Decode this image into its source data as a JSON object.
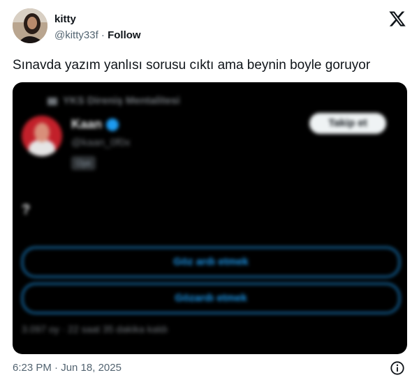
{
  "author": {
    "name": "kitty",
    "handle": "@kitty33f",
    "separator": " · ",
    "follow_label": "Follow"
  },
  "platform_icon": "x-logo-icon",
  "tweet": {
    "text": "Sınavda yazım yanlısı sorusu cıktı ama beynin boyle goruyor"
  },
  "embedded_poll": {
    "breadcrumb": "YKS Direniş Mentalitesi",
    "author_name": "Kaan",
    "author_handle": "@kaan_0f0x",
    "badge": "Üye",
    "follow_label": "Takip et",
    "text": "?",
    "options": [
      "Göz ardı etmek",
      "Gözardı etmek"
    ],
    "meta": "3.097 oy · 22 saat 35 dakika kaldı",
    "accent_color": "#1d9bf0"
  },
  "footer": {
    "timestamp": "6:23 PM · Jun 18, 2025",
    "info_icon": "info-icon"
  }
}
